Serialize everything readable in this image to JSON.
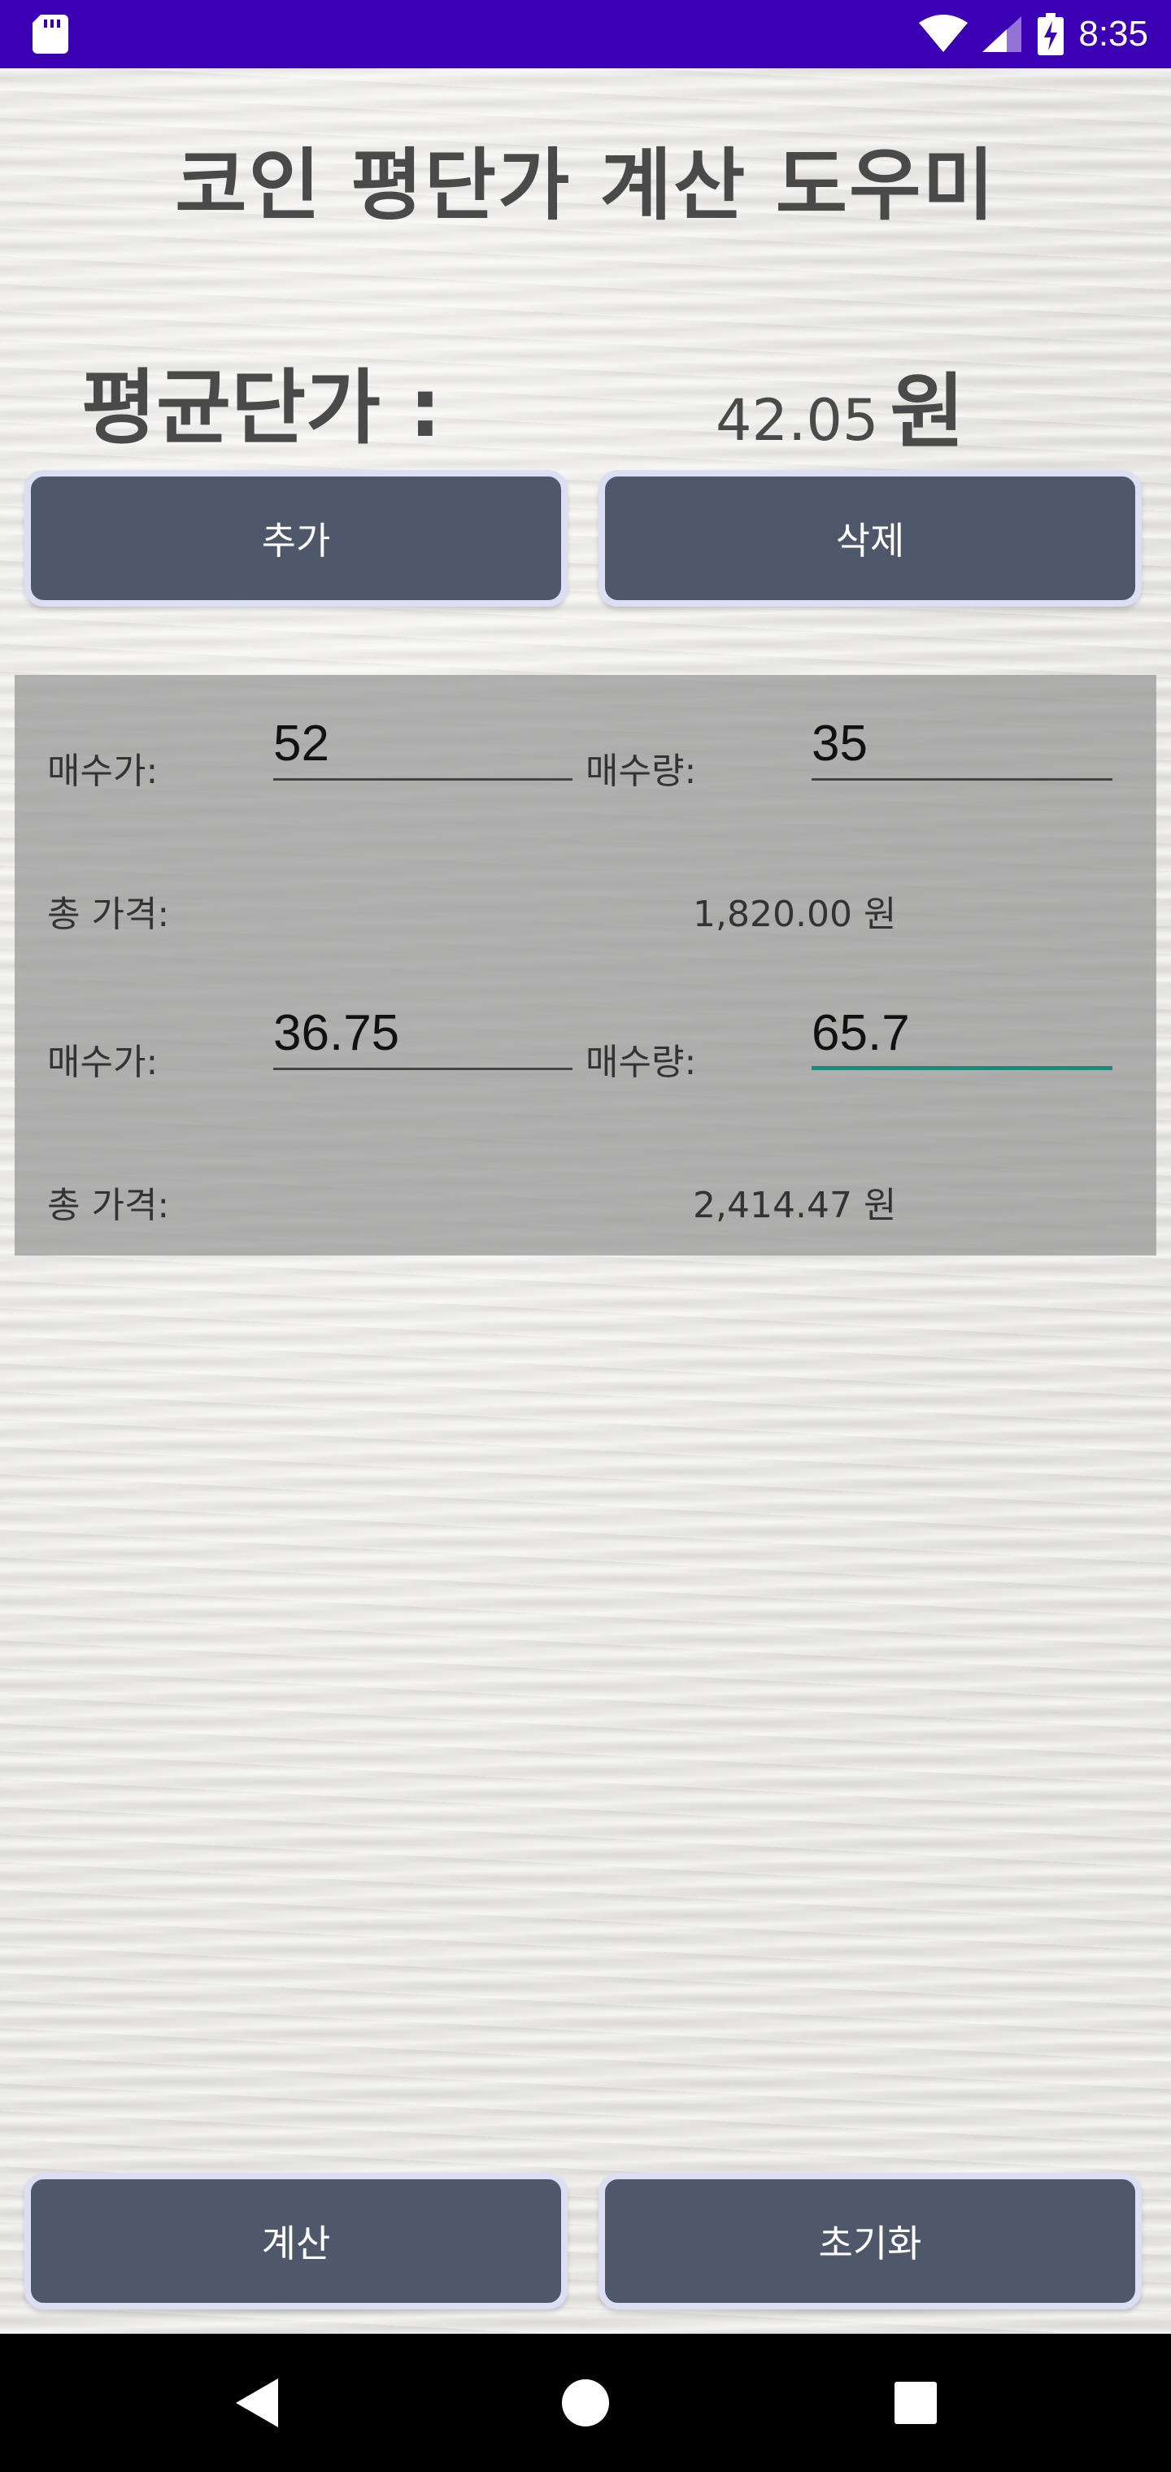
{
  "status_bar": {
    "time": "8:35",
    "icons": [
      "sd-card-icon",
      "wifi-icon",
      "signal-icon",
      "battery-charging-icon"
    ]
  },
  "title": "코인 평단가 계산 도우미",
  "average": {
    "label": "평균단가 :",
    "value": "42.05",
    "unit": "원"
  },
  "buttons": {
    "add": "추가",
    "delete": "삭제",
    "calculate": "계산",
    "reset": "초기화"
  },
  "entries": [
    {
      "price_label": "매수가:",
      "price": "52",
      "qty_label": "매수량:",
      "qty": "35",
      "total_label": "총 가격:",
      "total": "1,820.00 원"
    },
    {
      "price_label": "매수가:",
      "price": "36.75",
      "qty_label": "매수량:",
      "qty": "65.7",
      "total_label": "총 가격:",
      "total": "2,414.47 원"
    }
  ],
  "colors": {
    "status_bar": "#3b00b3",
    "button": "#4f586b",
    "button_border": "#dcdff3",
    "focus_underline": "#138d7c"
  }
}
